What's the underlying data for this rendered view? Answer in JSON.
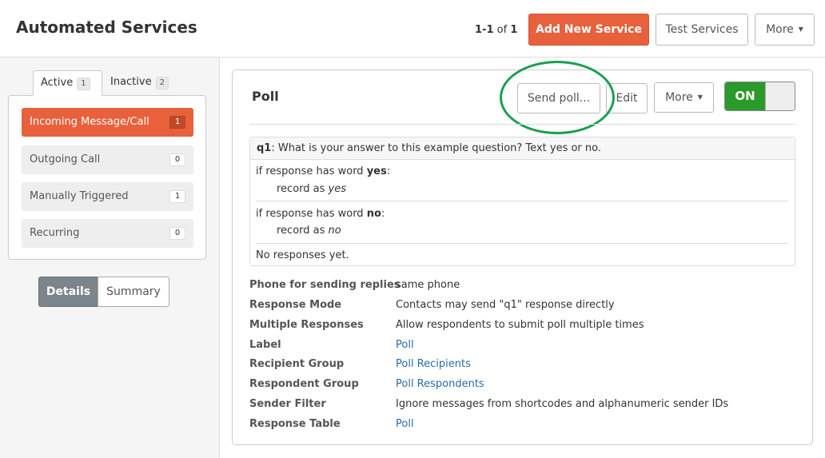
{
  "header": {
    "title": "Automated Services",
    "pager": {
      "range": "1-1",
      "of": "of",
      "total": "1"
    },
    "add_label": "Add New Service",
    "test_label": "Test Services",
    "more_label": "More"
  },
  "sidebar": {
    "tabs": [
      {
        "label": "Active",
        "count": "1"
      },
      {
        "label": "Inactive",
        "count": "2"
      }
    ],
    "categories": [
      {
        "label": "Incoming Message/Call",
        "count": "1"
      },
      {
        "label": "Outgoing Call",
        "count": "0"
      },
      {
        "label": "Manually Triggered",
        "count": "1"
      },
      {
        "label": "Recurring",
        "count": "0"
      }
    ],
    "view_toggle": {
      "details": "Details",
      "summary": "Summary"
    }
  },
  "service": {
    "title": "Poll",
    "send_label": "Send poll...",
    "edit_label": "Edit",
    "more_label": "More",
    "toggle_label": "ON",
    "question": {
      "id": "q1",
      "text": ": What is your answer to this example question? Text yes or no."
    },
    "rules": [
      {
        "prefix": "if response has word ",
        "word": "yes",
        "suffix": ":",
        "action": "record as ",
        "value": "yes"
      },
      {
        "prefix": "if response has word ",
        "word": "no",
        "suffix": ":",
        "action": "record as ",
        "value": "no"
      }
    ],
    "no_responses": "No responses yet.",
    "details": [
      {
        "label": "Phone for sending replies",
        "value": "same phone"
      },
      {
        "label": "Response Mode",
        "value": "Contacts may send \"q1\" response directly"
      },
      {
        "label": "Multiple Responses",
        "value": "Allow respondents to submit poll multiple times"
      },
      {
        "label": "Label",
        "value": "Poll"
      },
      {
        "label": "Recipient Group",
        "value": "Poll Recipients"
      },
      {
        "label": "Respondent Group",
        "value": "Poll Respondents"
      },
      {
        "label": "Sender Filter",
        "value": "Ignore messages from shortcodes and alphanumeric sender IDs"
      },
      {
        "label": "Response Table",
        "value": "Poll"
      }
    ]
  },
  "colors": {
    "accent": "#e8603c",
    "toggle_on": "#2a9a2a",
    "highlight_circle": "#1a9f4e",
    "link": "#2a6ca8"
  },
  "icons": {
    "caret": "caret-down-icon"
  }
}
